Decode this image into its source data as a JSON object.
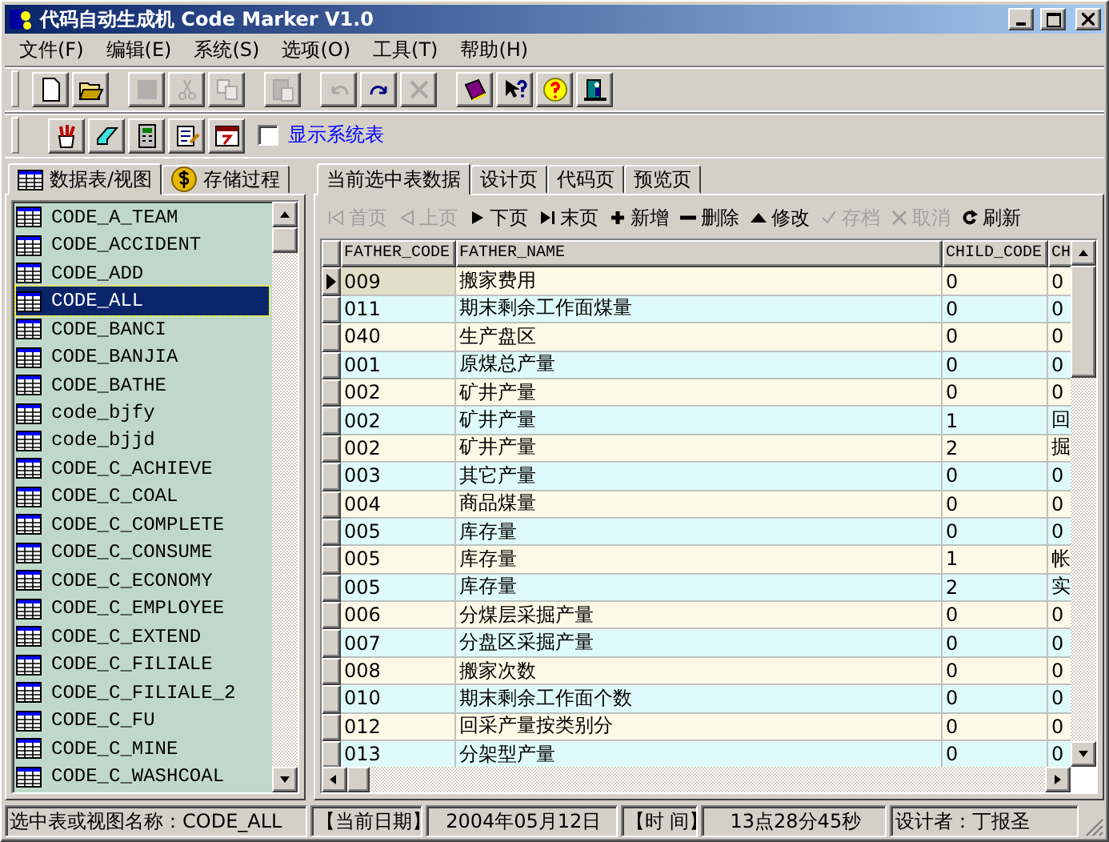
{
  "window": {
    "title": "代码自动生成机 Code Marker V1.0"
  },
  "menu": [
    "文件(F)",
    "编辑(E)",
    "系统(S)",
    "选项(O)",
    "工具(T)",
    "帮助(H)"
  ],
  "toolbar": [
    {
      "kind": "new",
      "disabled": false
    },
    {
      "kind": "open",
      "disabled": false
    },
    {
      "kind": "save",
      "disabled": true
    },
    {
      "kind": "cut",
      "disabled": true
    },
    {
      "kind": "copy",
      "disabled": true
    },
    {
      "kind": "paste",
      "disabled": true
    },
    {
      "kind": "undo",
      "disabled": true
    },
    {
      "kind": "redo",
      "disabled": false
    },
    {
      "kind": "delete",
      "disabled": true
    },
    {
      "kind": "book",
      "disabled": false
    },
    {
      "kind": "whatsthis",
      "disabled": false
    },
    {
      "kind": "help",
      "disabled": false
    },
    {
      "kind": "exit",
      "disabled": false
    }
  ],
  "toolbar2": [
    {
      "kind": "brushes"
    },
    {
      "kind": "eraser"
    },
    {
      "kind": "calculator"
    },
    {
      "kind": "notepad"
    },
    {
      "kind": "calendar"
    }
  ],
  "show_system_tables": {
    "label": "显示系统表",
    "checked": false
  },
  "left_tabs": [
    {
      "label": "数据表/视图",
      "kind": "table",
      "selected": true
    },
    {
      "label": "存储过程",
      "kind": "coin",
      "selected": false
    }
  ],
  "right_tabs": [
    {
      "label": "当前选中表数据",
      "selected": true
    },
    {
      "label": "设计页",
      "selected": false
    },
    {
      "label": "代码页",
      "selected": false
    },
    {
      "label": "预览页",
      "selected": false
    }
  ],
  "tables": [
    {
      "name": "CODE_A_TEAM",
      "selected": false
    },
    {
      "name": "CODE_ACCIDENT",
      "selected": false
    },
    {
      "name": "CODE_ADD",
      "selected": false
    },
    {
      "name": "CODE_ALL",
      "selected": true
    },
    {
      "name": "CODE_BANCI",
      "selected": false
    },
    {
      "name": "CODE_BANJIA",
      "selected": false
    },
    {
      "name": "CODE_BATHE",
      "selected": false
    },
    {
      "name": "code_bjfy",
      "selected": false
    },
    {
      "name": "code_bjjd",
      "selected": false
    },
    {
      "name": "CODE_C_ACHIEVE",
      "selected": false
    },
    {
      "name": "CODE_C_COAL",
      "selected": false
    },
    {
      "name": "CODE_C_COMPLETE",
      "selected": false
    },
    {
      "name": "CODE_C_CONSUME",
      "selected": false
    },
    {
      "name": "CODE_C_ECONOMY",
      "selected": false
    },
    {
      "name": "CODE_C_EMPLOYEE",
      "selected": false
    },
    {
      "name": "CODE_C_EXTEND",
      "selected": false
    },
    {
      "name": "CODE_C_FILIALE",
      "selected": false
    },
    {
      "name": "CODE_C_FILIALE_2",
      "selected": false
    },
    {
      "name": "CODE_C_FU",
      "selected": false
    },
    {
      "name": "CODE_C_MINE",
      "selected": false
    },
    {
      "name": "CODE_C_WASHCOAL",
      "selected": false
    }
  ],
  "navigator": [
    {
      "label": "首页",
      "kind": "first",
      "disabled": true
    },
    {
      "label": "上页",
      "kind": "prev",
      "disabled": true
    },
    {
      "label": "下页",
      "kind": "next",
      "disabled": false
    },
    {
      "label": "末页",
      "kind": "last",
      "disabled": false
    },
    {
      "label": "新增",
      "kind": "add",
      "disabled": false
    },
    {
      "label": "删除",
      "kind": "delete",
      "disabled": false
    },
    {
      "label": "修改",
      "kind": "edit",
      "disabled": false
    },
    {
      "label": "存档",
      "kind": "save",
      "disabled": true
    },
    {
      "label": "取消",
      "kind": "cancel",
      "disabled": true
    },
    {
      "label": "刷新",
      "kind": "refresh",
      "disabled": false
    }
  ],
  "grid": {
    "columns": [
      "FATHER_CODE",
      "FATHER_NAME",
      "CHILD_CODE",
      "CH"
    ],
    "rows": [
      {
        "cells": [
          "009",
          "搬家费用",
          "0",
          "0"
        ],
        "current": true
      },
      {
        "cells": [
          "011",
          "期末剩余工作面煤量",
          "0",
          "0"
        ],
        "current": false
      },
      {
        "cells": [
          "040",
          "生产盘区",
          "0",
          "0"
        ],
        "current": false
      },
      {
        "cells": [
          "001",
          "原煤总产量",
          "0",
          "0"
        ],
        "current": false
      },
      {
        "cells": [
          "002",
          "矿井产量",
          "0",
          "0"
        ],
        "current": false
      },
      {
        "cells": [
          "002",
          "矿井产量",
          "1",
          "回"
        ],
        "current": false
      },
      {
        "cells": [
          "002",
          "矿井产量",
          "2",
          "掘"
        ],
        "current": false
      },
      {
        "cells": [
          "003",
          "其它产量",
          "0",
          "0"
        ],
        "current": false
      },
      {
        "cells": [
          "004",
          "商品煤量",
          "0",
          "0"
        ],
        "current": false
      },
      {
        "cells": [
          "005",
          "库存量",
          "0",
          "0"
        ],
        "current": false
      },
      {
        "cells": [
          "005",
          "库存量",
          "1",
          "帐"
        ],
        "current": false
      },
      {
        "cells": [
          "005",
          "库存量",
          "2",
          "实"
        ],
        "current": false
      },
      {
        "cells": [
          "006",
          "分煤层采掘产量",
          "0",
          "0"
        ],
        "current": false
      },
      {
        "cells": [
          "007",
          "分盘区采掘产量",
          "0",
          "0"
        ],
        "current": false
      },
      {
        "cells": [
          "008",
          "搬家次数",
          "0",
          "0"
        ],
        "current": false
      },
      {
        "cells": [
          "010",
          "期末剩余工作面个数",
          "0",
          "0"
        ],
        "current": false
      },
      {
        "cells": [
          "012",
          "回采产量按类别分",
          "0",
          "0"
        ],
        "current": false
      },
      {
        "cells": [
          "013",
          "分架型产量",
          "0",
          "0"
        ],
        "current": false
      }
    ]
  },
  "status_bar": {
    "selected_name": "选中表或视图名称：CODE_ALL",
    "date_label": "【当前日期】",
    "date": "2004年05月12日",
    "time_label": "【时 间】",
    "time": "13点28分45秒",
    "designer": "设计者：丁报圣"
  }
}
